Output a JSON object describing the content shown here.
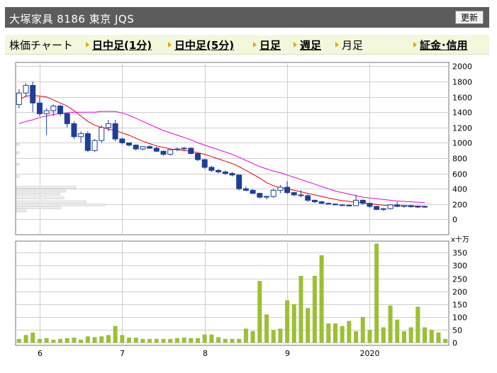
{
  "header": {
    "title": "大塚家具 8186 東京 JQS",
    "refresh_label": "更新"
  },
  "tabs": [
    {
      "label": "株価チャート",
      "link": false,
      "arrow": false
    },
    {
      "label": "日中足(1分)",
      "link": true,
      "arrow": true
    },
    {
      "label": "日中足(5分)",
      "link": true,
      "arrow": true
    },
    {
      "label": "日足",
      "link": true,
      "arrow": true
    },
    {
      "label": "週足",
      "link": true,
      "arrow": true
    },
    {
      "label": "月足",
      "link": false,
      "arrow": true
    },
    {
      "label": "証金･信用",
      "link": true,
      "arrow": true
    }
  ],
  "colors": {
    "candle_down": "#1f3e99",
    "candle_up_border": "#1f3e99",
    "ma_short": "#e60000",
    "ma_long": "#e600e6",
    "volume_bar": "#9dbf35",
    "grid": "#cfcfcf"
  },
  "chart_data": [
    {
      "type": "candlestick",
      "name": "price",
      "ylim": [
        -200,
        2050
      ],
      "yticks": [
        0,
        200,
        400,
        600,
        800,
        1000,
        1200,
        1400,
        1600,
        1800,
        2000
      ],
      "x_labels": [
        {
          "label": "6",
          "index": 3
        },
        {
          "label": "7",
          "index": 15
        },
        {
          "label": "8",
          "index": 27
        },
        {
          "label": "9",
          "index": 39
        },
        {
          "label": "2020",
          "index": 51
        }
      ],
      "grid": true,
      "candles": [
        [
          1500,
          1700,
          1450,
          1650
        ],
        [
          1650,
          1780,
          1600,
          1750
        ],
        [
          1750,
          1800,
          1400,
          1520
        ],
        [
          1520,
          1600,
          1350,
          1380
        ],
        [
          1380,
          1450,
          1100,
          1420
        ],
        [
          1420,
          1500,
          1350,
          1480
        ],
        [
          1480,
          1500,
          1350,
          1380
        ],
        [
          1380,
          1400,
          1200,
          1250
        ],
        [
          1250,
          1280,
          1050,
          1080
        ],
        [
          1080,
          1150,
          1000,
          1120
        ],
        [
          1120,
          1150,
          880,
          900
        ],
        [
          900,
          1050,
          880,
          1030
        ],
        [
          1030,
          1230,
          1000,
          1200
        ],
        [
          1200,
          1300,
          1150,
          1250
        ],
        [
          1250,
          1300,
          1020,
          1050
        ],
        [
          1050,
          1070,
          980,
          1000
        ],
        [
          1000,
          1000,
          950,
          970
        ],
        [
          970,
          980,
          900,
          920
        ],
        [
          920,
          960,
          900,
          950
        ],
        [
          950,
          970,
          920,
          930
        ],
        [
          930,
          950,
          880,
          890
        ],
        [
          890,
          900,
          830,
          850
        ],
        [
          850,
          920,
          830,
          910
        ],
        [
          910,
          940,
          890,
          920
        ],
        [
          920,
          950,
          890,
          930
        ],
        [
          930,
          940,
          850,
          860
        ],
        [
          860,
          870,
          760,
          780
        ],
        [
          780,
          790,
          660,
          680
        ],
        [
          680,
          700,
          620,
          640
        ],
        [
          640,
          660,
          600,
          620
        ],
        [
          620,
          640,
          580,
          600
        ],
        [
          600,
          620,
          560,
          580
        ],
        [
          580,
          580,
          380,
          400
        ],
        [
          400,
          430,
          370,
          380
        ],
        [
          380,
          400,
          330,
          340
        ],
        [
          340,
          350,
          270,
          290
        ],
        [
          290,
          310,
          260,
          300
        ],
        [
          300,
          400,
          280,
          380
        ],
        [
          380,
          450,
          340,
          420
        ],
        [
          420,
          500,
          330,
          350
        ],
        [
          350,
          360,
          300,
          320
        ],
        [
          320,
          380,
          290,
          310
        ],
        [
          310,
          330,
          230,
          250
        ],
        [
          250,
          260,
          210,
          230
        ],
        [
          230,
          240,
          200,
          210
        ],
        [
          210,
          220,
          195,
          200
        ],
        [
          200,
          210,
          185,
          190
        ],
        [
          190,
          200,
          175,
          185
        ],
        [
          185,
          195,
          170,
          180
        ],
        [
          180,
          320,
          175,
          250
        ],
        [
          250,
          260,
          190,
          210
        ],
        [
          210,
          220,
          150,
          170
        ],
        [
          170,
          180,
          120,
          130
        ],
        [
          130,
          150,
          110,
          140
        ],
        [
          140,
          200,
          130,
          190
        ],
        [
          190,
          230,
          160,
          170
        ],
        [
          170,
          190,
          150,
          180
        ],
        [
          180,
          190,
          155,
          165
        ],
        [
          165,
          180,
          150,
          170
        ],
        [
          170,
          180,
          150,
          160
        ]
      ],
      "series": [
        {
          "name": "ma_short",
          "values": [
            1560,
            1610,
            1620,
            1610,
            1600,
            1560,
            1520,
            1480,
            1420,
            1350,
            1280,
            1230,
            1200,
            1180,
            1160,
            1130,
            1100,
            1060,
            1020,
            990,
            960,
            940,
            920,
            910,
            900,
            890,
            870,
            850,
            820,
            790,
            760,
            730,
            690,
            640,
            590,
            540,
            480,
            440,
            410,
            400,
            380,
            360,
            340,
            320,
            300,
            280,
            260,
            245,
            235,
            225,
            215,
            205,
            195,
            185,
            180,
            180,
            180,
            175,
            175,
            170
          ]
        },
        {
          "name": "ma_long",
          "values": [
            1250,
            1280,
            1300,
            1330,
            1350,
            1370,
            1380,
            1390,
            1400,
            1400,
            1400,
            1400,
            1410,
            1410,
            1410,
            1390,
            1360,
            1320,
            1280,
            1240,
            1200,
            1160,
            1130,
            1100,
            1070,
            1040,
            1000,
            970,
            940,
            910,
            880,
            850,
            810,
            770,
            730,
            690,
            660,
            630,
            610,
            580,
            550,
            520,
            490,
            460,
            430,
            400,
            370,
            350,
            330,
            310,
            290,
            280,
            270,
            260,
            250,
            240,
            235,
            230,
            225,
            220
          ]
        }
      ],
      "price_profile": [
        {
          "price": 980,
          "share": 0.03
        },
        {
          "price": 870,
          "share": 0.03
        },
        {
          "price": 720,
          "share": 0.03
        },
        {
          "price": 560,
          "share": 0.03
        },
        {
          "price": 420,
          "share": 0.6
        },
        {
          "price": 370,
          "share": 0.5
        },
        {
          "price": 330,
          "share": 0.44
        },
        {
          "price": 280,
          "share": 0.48
        },
        {
          "price": 230,
          "share": 0.7
        },
        {
          "price": 190,
          "share": 0.9
        },
        {
          "price": 150,
          "share": 0.45
        },
        {
          "price": 110,
          "share": 0.1
        }
      ]
    },
    {
      "type": "bar",
      "name": "volume",
      "unit_label": "x十万",
      "ylim": [
        -10,
        395
      ],
      "yticks": [
        0,
        50,
        100,
        150,
        200,
        250,
        300,
        350
      ],
      "values": [
        15,
        30,
        40,
        15,
        18,
        12,
        15,
        18,
        20,
        12,
        25,
        22,
        25,
        30,
        65,
        30,
        20,
        20,
        15,
        15,
        15,
        15,
        15,
        18,
        20,
        18,
        18,
        32,
        32,
        22,
        15,
        15,
        15,
        55,
        45,
        240,
        110,
        50,
        55,
        165,
        150,
        260,
        135,
        260,
        340,
        75,
        75,
        65,
        85,
        45,
        100,
        50,
        385,
        60,
        145,
        90,
        45,
        60,
        140,
        60,
        50,
        40,
        15
      ]
    }
  ]
}
